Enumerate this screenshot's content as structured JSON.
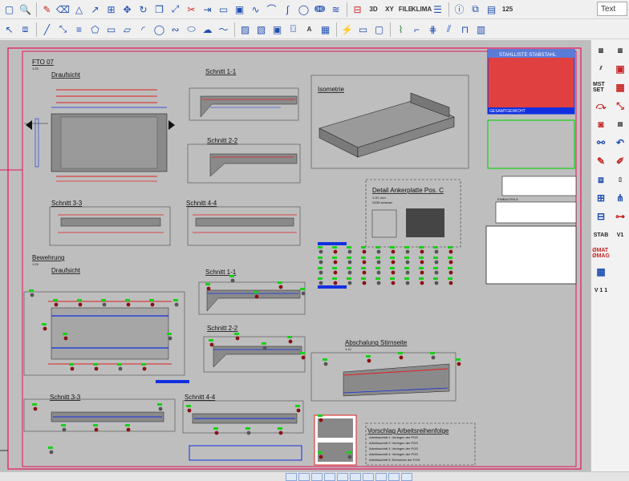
{
  "toolbar_top": {
    "buttons": [
      "square-icon",
      "zoom-icon",
      "pencil-icon",
      "eraser-icon",
      "triangle-icon",
      "arrow-icon",
      "grid-icon",
      "move-icon",
      "rotate-icon",
      "copy-icon",
      "scale-icon",
      "scissors-icon",
      "line-end-icon",
      "rect-icon",
      "block-icon",
      "wave-icon",
      "arc-icon",
      "curve-icon",
      "circle-icon",
      "spiral-icon",
      "spring-icon"
    ],
    "dim_label": "3D",
    "xy_label": "XY",
    "file_label": "FILE",
    "klima_label": "KLIMA",
    "count_label": "125",
    "text_label": "Text"
  },
  "canvas": {
    "sheet_title": "FTO 07",
    "sheet_sub": "1:25",
    "views": {
      "draufsicht_1": "Draufsicht",
      "schnitt_1_1_a": "Schnitt 1-1",
      "schnitt_2_2_a": "Schnitt 2-2",
      "isometrie": "Isometrie",
      "schnitt_3_3_a": "Schnitt 3-3",
      "schnitt_4_4_a": "Schnitt 4-4",
      "detail_anker": "Detail Ankerplatte Pos. C",
      "detail_scale": "1:20, mm",
      "detail_steel": "S235 schwarz",
      "bewehrung": "Bewehrung",
      "bewehrung_scale": "1:25",
      "draufsicht_2": "Draufsicht",
      "schnitt_1_1_b": "Schnitt 1-1",
      "schnitt_2_2_b": "Schnitt 2-2",
      "abschalung": "Abschalung Stirnseite",
      "abschalung_scale": "1:10",
      "schnitt_3_3_b": "Schnitt 3-3",
      "schnitt_4_4_b": "Schnitt 4-4",
      "vorschlag": "Vorschlag Arbeitsreihenfolge"
    },
    "stahlliste_title": "STAHLLISTE  STABSTAHL",
    "gesamtgewicht": "GESAMTGEWICHT",
    "einbauteile": "EINBAUTEILE",
    "arbeitsschritte": [
      "Arbeitsschritt 1: Verlegen der POS",
      "Arbeitsschritt 2: Verlegen der POS",
      "Arbeitsschritt 3: Verlegen der POS",
      "Arbeitsschritt 4: Verlegen der POS",
      "Arbeitsschritt 5: Einformen der POS"
    ]
  },
  "right_panel": {
    "col1": [
      "ruler-icon",
      "hatch-icon",
      "mst-set-icon",
      "red-curve-icon",
      "bag-icon",
      "connect-icon",
      "pen-icon",
      "stack-icon",
      "grid-small-icon",
      "grid-large-icon",
      "stab-icon",
      "omat-icon",
      "table-icon",
      "v11-icon"
    ],
    "mst_label": "MST SET",
    "stab_label": "STAB",
    "omat_label": "ØMAT ØMAG",
    "v11_label": "V 1 1",
    "v1_label": "V1"
  },
  "colors": {
    "frame": "#e8125a",
    "red_line": "#e02020",
    "blue_line": "#1030e0",
    "green_mark": "#18d018",
    "dark_mark": "#8a1010",
    "paper": "#bebebe"
  }
}
